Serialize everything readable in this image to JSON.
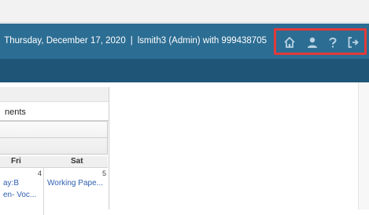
{
  "header": {
    "date_text": "Thursday, December 17, 2020",
    "separator": "|",
    "user_text": "lsmith3 (Admin) with 999438705",
    "icons": [
      "home-icon",
      "user-icon",
      "help-icon",
      "logout-icon"
    ]
  },
  "calendar": {
    "title_fragment": "nents",
    "days": [
      "Fri",
      "Sat"
    ],
    "cells": [
      {
        "day_number": "4",
        "events": [
          "ay:B",
          "en- Voc..."
        ]
      },
      {
        "day_number": "5",
        "events": [
          "Working Pape..."
        ]
      }
    ]
  },
  "colors": {
    "header_bar": "#2c6d93",
    "nav_bar": "#1f5677",
    "highlight_box": "#e03a3a",
    "icon": "#b9d3e4",
    "event_link": "#2f5fb2"
  }
}
